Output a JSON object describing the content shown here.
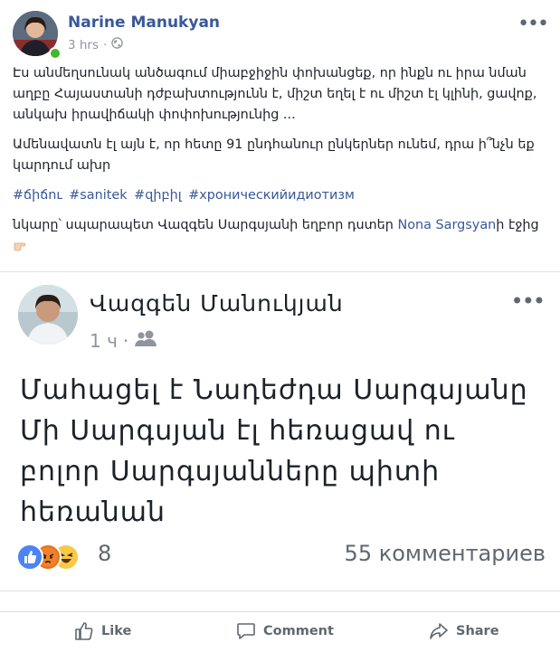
{
  "post": {
    "author": "Narine Manukyan",
    "time": "3 hrs",
    "dot": "·",
    "more": "•••",
    "paragraph1": "Էս անմեղսունակ անծագում միաբջիջին փոխանցեք, որ ինքն ու իրա նման աղբը Հայաստանի դժբախտությունն է, միշտ եղել է ու միշտ էլ կլինի, ցավոք, անկախ իրավիճակի փոփոխությունից ...",
    "paragraph2": "Ամենավատն էլ այն է, որ հետը 91 ընդհանուր ընկերներ ունեմ, դրա ի՞նչն եք կարդում ախր",
    "hashtags": [
      "#ճիճու",
      "#sanitek",
      "#զիբիլ",
      "#хроническийидиотизм"
    ],
    "caption_prefix": "նկարը՝ սպարապետ Վազգեն Սարգսյանի եղբոր դստեր ",
    "caption_link": "Nona Sargsyan",
    "caption_suffix": "ի էջից"
  },
  "shared": {
    "author": "Վազգեն Մանուկյան",
    "time": "1 ч",
    "dot": "·",
    "more": "•••",
    "lines": [
      "Մահացել է Նադեժդա Սարգսյանը",
      "Մի Սարգսյան էլ հեռացավ ու",
      "բոլոր Սարգսյանները  պիտի",
      "հեռանան"
    ],
    "reaction_count": "8",
    "comments": "55 комментариев"
  },
  "actions": {
    "like": "Like",
    "comment": "Comment",
    "share": "Share"
  },
  "colors": {
    "link": "#385898",
    "muted": "#90949c",
    "like_blue": "#4c83f5",
    "angry_orange": "#e9710f",
    "haha_yellow": "#f7c948"
  }
}
